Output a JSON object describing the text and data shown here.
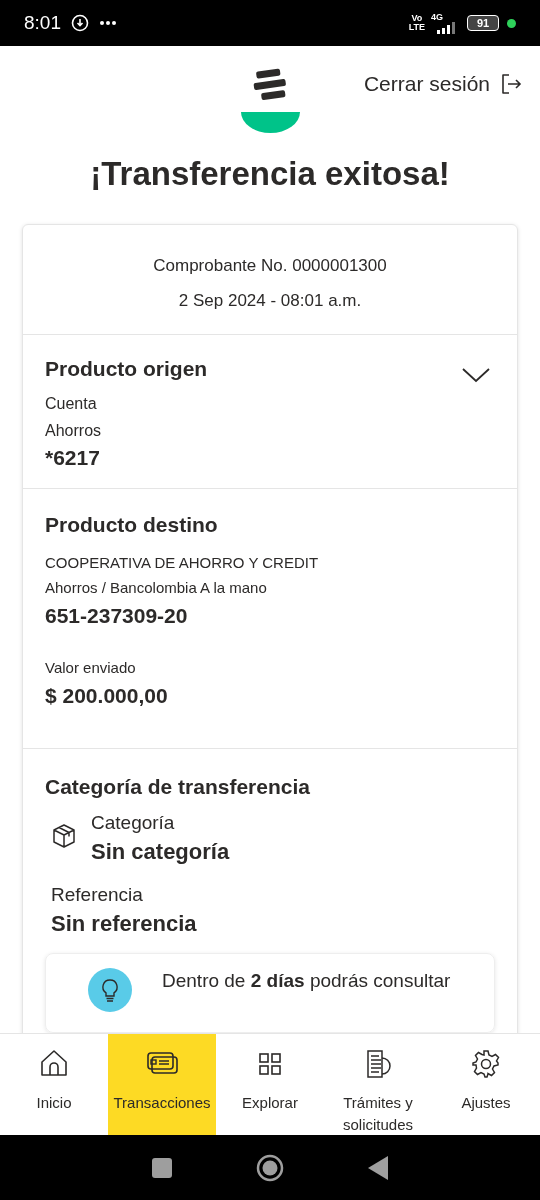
{
  "status_bar": {
    "time": "8:01",
    "volte_top": "Vo",
    "volte_bottom": "LTE",
    "network": "4G",
    "battery": "91"
  },
  "header": {
    "logout": "Cerrar sesión"
  },
  "title": "¡Transferencia exitosa!",
  "receipt": {
    "number": "Comprobante No. 0000001300",
    "date": "2 Sep 2024 - 08:01 a.m."
  },
  "origin": {
    "title": "Producto origen",
    "expanded": false,
    "lines": [
      "Cuenta",
      "Ahorros"
    ],
    "account": "*6217"
  },
  "destination": {
    "title": "Producto destino",
    "lines": [
      "COOPERATIVA DE AHORRO Y CREDIT",
      "Ahorros / Bancolombia A la mano"
    ],
    "account": "651-237309-20",
    "amount_label": "Valor enviado",
    "amount": "$ 200.000,00"
  },
  "category": {
    "title": "Categoría de transferencia",
    "category_label": "Categoría",
    "category_value": "Sin categoría",
    "reference_label": "Referencia",
    "reference_value": "Sin referencia"
  },
  "notice": {
    "text": "Dentro de **2 días** podrás consultar"
  },
  "bottom_nav": [
    {
      "kind": "home",
      "label": "Inicio",
      "selected": false
    },
    {
      "kind": "cards",
      "label": "Transacciones",
      "selected": true
    },
    {
      "kind": "grid",
      "label": "Explorar",
      "selected": false
    },
    {
      "kind": "documents",
      "label": "Trámites y solicitudes",
      "selected": false
    },
    {
      "kind": "settings",
      "label": "Ajustes",
      "selected": false
    }
  ]
}
